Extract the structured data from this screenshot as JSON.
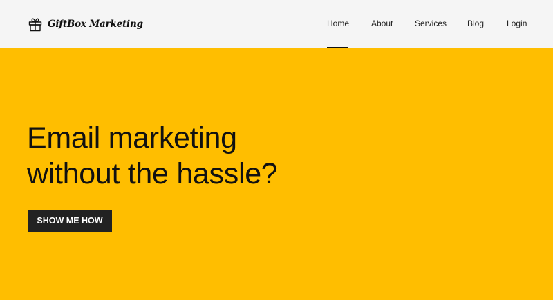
{
  "brand": {
    "name": "GiftBox Marketing",
    "icon": "gift-icon"
  },
  "nav": {
    "items": [
      {
        "label": "Home",
        "active": true
      },
      {
        "label": "About",
        "active": false
      },
      {
        "label": "Services",
        "active": false
      },
      {
        "label": "Blog",
        "active": false
      },
      {
        "label": "Login",
        "active": false
      }
    ]
  },
  "hero": {
    "title_line1": "Email marketing",
    "title_line2": "without the hassle?",
    "cta_label": "SHOW ME HOW"
  },
  "colors": {
    "navbar_bg": "#f5f5f5",
    "hero_bg": "#ffbe00",
    "button_bg": "#222222",
    "text": "#111111"
  }
}
